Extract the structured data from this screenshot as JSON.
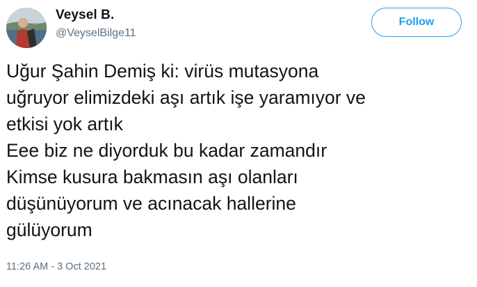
{
  "user": {
    "display_name": "Veysel B.",
    "handle": "@VeyselBilge11",
    "avatar_icon": "profile-photo"
  },
  "follow_button": {
    "label": "Follow",
    "color": "#1da1f2"
  },
  "tweet": {
    "lines": [
      "Uğur Şahin Demiş ki: virüs mutasyona",
      "uğruyor elimizdeki aşı artık işe yaramıyor ve",
      "etkisi yok artık",
      "Eee biz ne diyorduk bu kadar zamandır",
      "Kimse kusura bakmasın aşı olanları",
      "düşünüyorum ve acınacak hallerine",
      "gülüyorum"
    ],
    "timestamp": "11:26 AM - 3 Oct 2021"
  },
  "colors": {
    "text": "#0f1419",
    "secondary_text": "#5b7083",
    "accent": "#1da1f2"
  }
}
